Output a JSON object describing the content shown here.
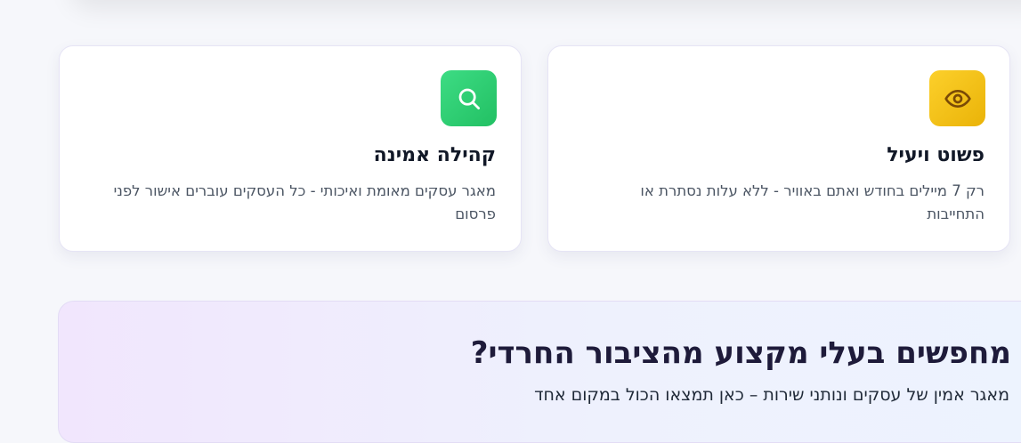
{
  "features": [
    {
      "icon": "search-icon",
      "title": "קהילה אמינה",
      "text": "מאגר עסקים מאומת ואיכותי - כל העסקים עוברים אישור לפני פרסום",
      "color": "#2ecc71"
    },
    {
      "icon": "eye-icon",
      "title": "פשוט ויעיל",
      "text": "רק 7 מיילים בחודש ואתם באוויר - ללא עלות נסתרת או התחייבות",
      "color": "#f5c211"
    }
  ],
  "banner": {
    "title": "מחפשים בעלי מקצוע מהציבור החרדי?",
    "subtitle": "מאגר אמין של עסקים ונותני שירות – כאן תמצאו הכול במקום אחד"
  }
}
